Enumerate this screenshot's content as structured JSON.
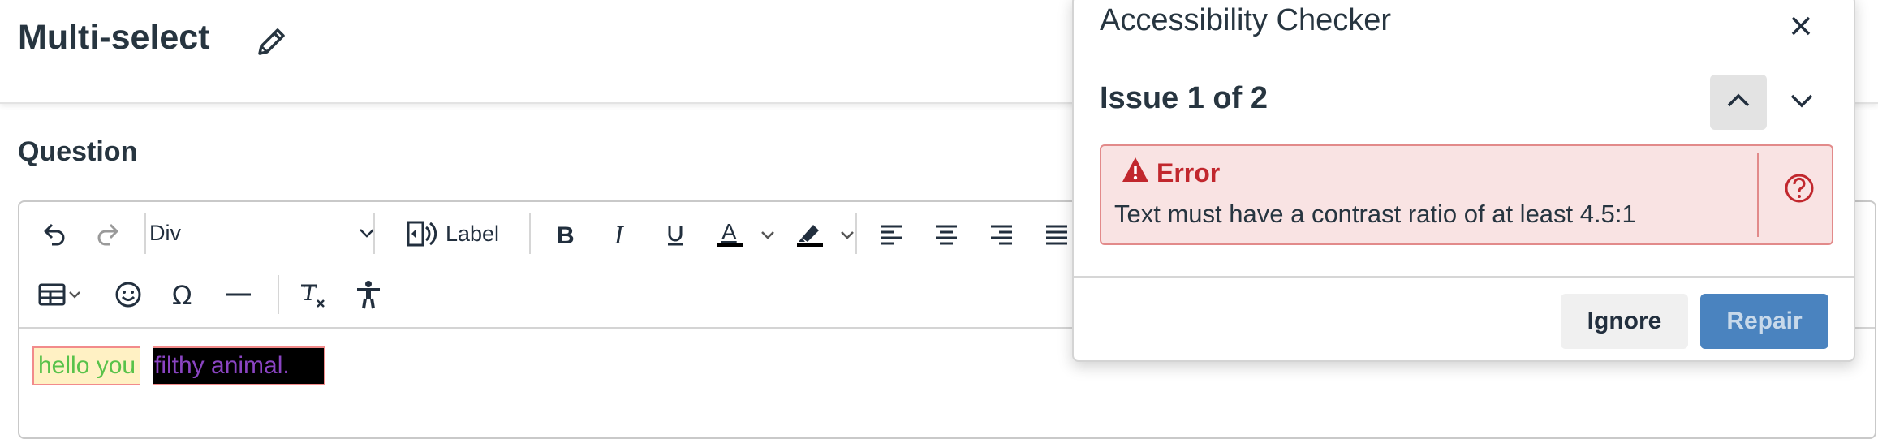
{
  "page": {
    "title": "Multi-select",
    "question_label": "Question"
  },
  "toolbar": {
    "block_format": "Div",
    "label_button": "Label",
    "icons": [
      "undo-icon",
      "redo-icon",
      "voice-label-icon",
      "bold-icon",
      "italic-icon",
      "underline-icon",
      "text-color-icon",
      "highlight-color-icon",
      "align-left-icon",
      "align-center-icon",
      "align-right-icon",
      "align-justify-icon",
      "table-icon",
      "emoji-icon",
      "omega-icon",
      "horizontal-rule-icon",
      "clear-formatting-icon",
      "accessibility-icon"
    ]
  },
  "content": {
    "text_a": "hello you",
    "text_b": "filthy animal."
  },
  "dialog": {
    "title": "Accessibility Checker",
    "issue_counter": "Issue 1 of 2",
    "error_heading": "Error",
    "error_message": "Text must have a contrast ratio of at least 4.5:1",
    "ignore_label": "Ignore",
    "repair_label": "Repair"
  },
  "colors": {
    "title_text": "#273540",
    "error_red": "#c1272d",
    "error_bg": "#f9e3e3",
    "repair_blue": "#4a83bf",
    "content_green": "#58c24a",
    "content_purple": "#8a44c2",
    "highlight_yellow": "#fff1c4"
  }
}
